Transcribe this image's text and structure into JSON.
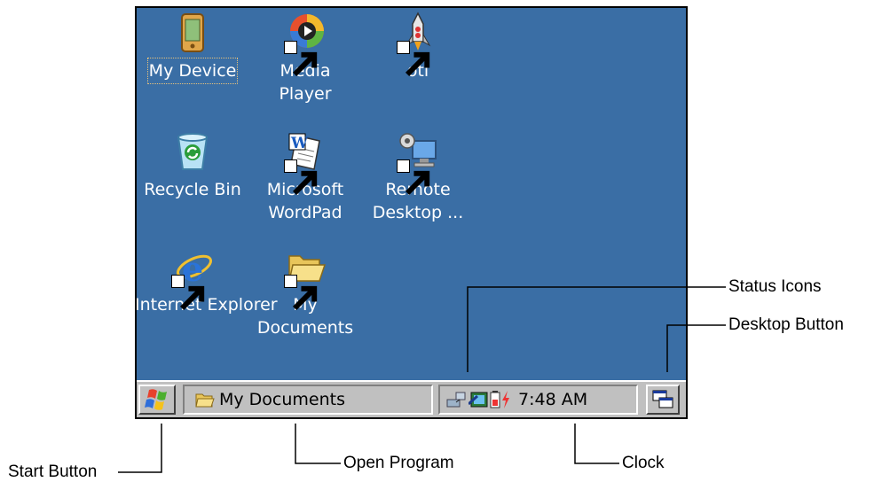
{
  "desktop": {
    "icons": [
      {
        "label": "My Device",
        "icon": "pda-device-icon"
      },
      {
        "label": "Media\nPlayer",
        "icon": "media-player-icon"
      },
      {
        "label": "otl",
        "icon": "rocket-icon"
      },
      {
        "label": "Recycle Bin",
        "icon": "recycle-bin-icon"
      },
      {
        "label": "Microsoft\nWordPad",
        "icon": "wordpad-icon"
      },
      {
        "label": "Remote\nDesktop ...",
        "icon": "remote-desktop-icon"
      },
      {
        "label": "Internet\nExplorer",
        "icon": "internet-explorer-icon"
      },
      {
        "label": "My\nDocuments",
        "icon": "folder-icon"
      }
    ],
    "background": "#3a6ea5"
  },
  "taskbar": {
    "open_program": "My Documents",
    "clock": "7:48 AM",
    "status_icons": [
      "network-icon",
      "connection-icon",
      "battery-icon",
      "charging-icon"
    ]
  },
  "callouts": {
    "status_icons": "Status Icons",
    "desktop_button": "Desktop Button",
    "start_button": "Start Button",
    "open_program": "Open Program",
    "clock": "Clock"
  }
}
